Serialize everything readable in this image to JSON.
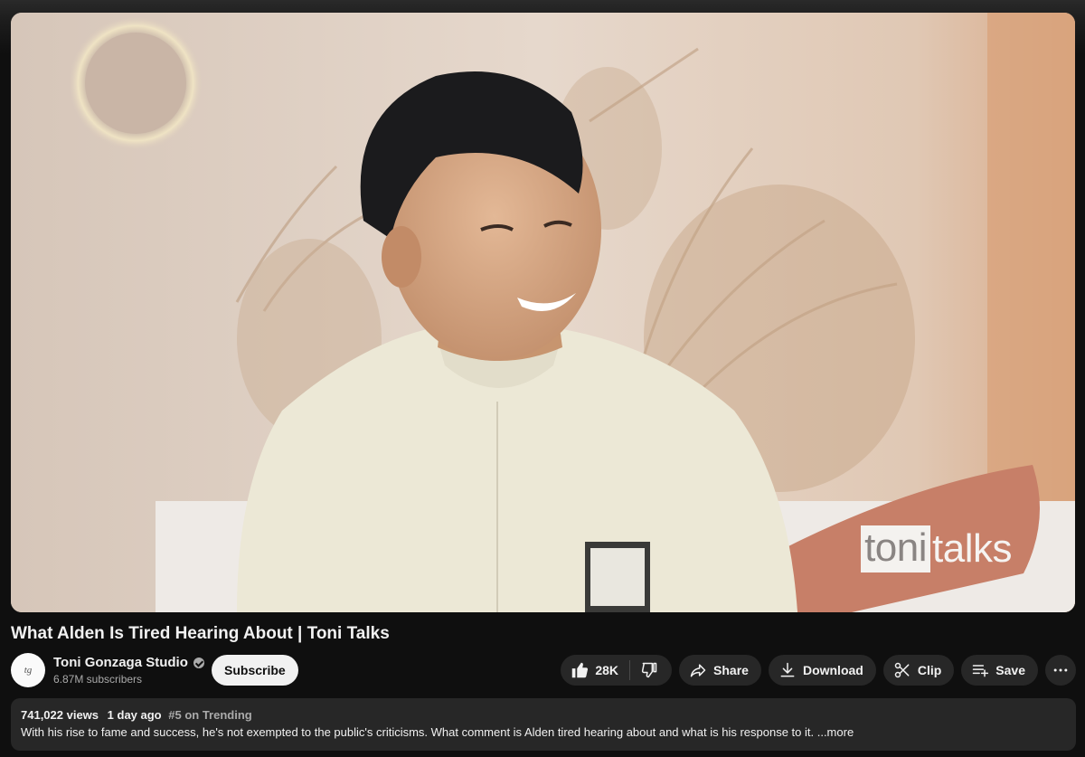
{
  "video": {
    "title": "What Alden Is Tired Hearing About | Toni Talks",
    "watermark_a": "toni",
    "watermark_b": "talks"
  },
  "channel": {
    "name": "Toni Gonzaga Studio",
    "subscribers": "6.87M subscribers",
    "verified": true,
    "avatar_icon": "tg-logo-icon"
  },
  "subscribe_label": "Subscribe",
  "actions": {
    "like_count": "28K",
    "like_icon": "thumbs-up-icon",
    "dislike_icon": "thumbs-down-icon",
    "share_label": "Share",
    "download_label": "Download",
    "clip_label": "Clip",
    "save_label": "Save",
    "more_icon": "more-horizontal-icon"
  },
  "description": {
    "views": "741,022 views",
    "date": "1 day ago",
    "trending": "#5 on Trending",
    "text": "With his rise to fame and success, he's not exempted to the public's criticisms. What comment is Alden tired hearing about and what is his response to it.",
    "more_label": " ...more"
  },
  "colors": {
    "background": "#0f0f0f",
    "pill": "#272727",
    "text": "#f1f1f1",
    "secondary_text": "#aaaaaa"
  }
}
